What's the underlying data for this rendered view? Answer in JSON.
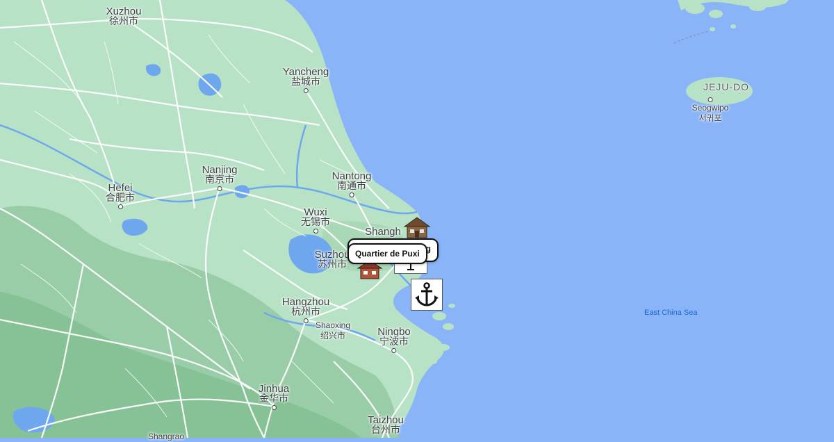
{
  "map": {
    "colors": {
      "sea": "#8ab4f8",
      "land": "#b6e0c4",
      "mountain": "#8cc59a",
      "road": "#ffffff",
      "lake": "#6ea7ee"
    },
    "sea_label": "East China Sea",
    "region_label": "JEJU-DO",
    "cities": [
      {
        "key": "xuzhou",
        "en": "Xuzhou",
        "zh": "徐州市"
      },
      {
        "key": "yancheng",
        "en": "Yancheng",
        "zh": "盐城市"
      },
      {
        "key": "nanjing",
        "en": "Nanjing",
        "zh": "南京市"
      },
      {
        "key": "nantong",
        "en": "Nantong",
        "zh": "南通市"
      },
      {
        "key": "hefei",
        "en": "Hefei",
        "zh": "合肥市"
      },
      {
        "key": "wuxi",
        "en": "Wuxi",
        "zh": "无锡市"
      },
      {
        "key": "shanghai",
        "en": "Shangh",
        "zh": ""
      },
      {
        "key": "suzhou",
        "en": "Suzhou",
        "zh": "苏州市"
      },
      {
        "key": "hangzhou",
        "en": "Hangzhou",
        "zh": "杭州市"
      },
      {
        "key": "shaoxing",
        "en": "Shaoxing",
        "zh": "绍兴市"
      },
      {
        "key": "ningbo",
        "en": "Ningbo",
        "zh": "宁波市"
      },
      {
        "key": "jinhua",
        "en": "Jinhua",
        "zh": "金华市"
      },
      {
        "key": "taizhou",
        "en": "Taizhou",
        "zh": "台州市"
      },
      {
        "key": "shangrao",
        "en": "Shangrao",
        "zh": ""
      },
      {
        "key": "seogwipo",
        "en": "Seogwipo",
        "zh": "서귀포"
      }
    ],
    "markers": {
      "callout_front": "Quartier de Puxi",
      "callout_back": "g",
      "anchor_icon": "anchor-icon",
      "house_icons": [
        "house-icon",
        "house-icon"
      ]
    }
  }
}
